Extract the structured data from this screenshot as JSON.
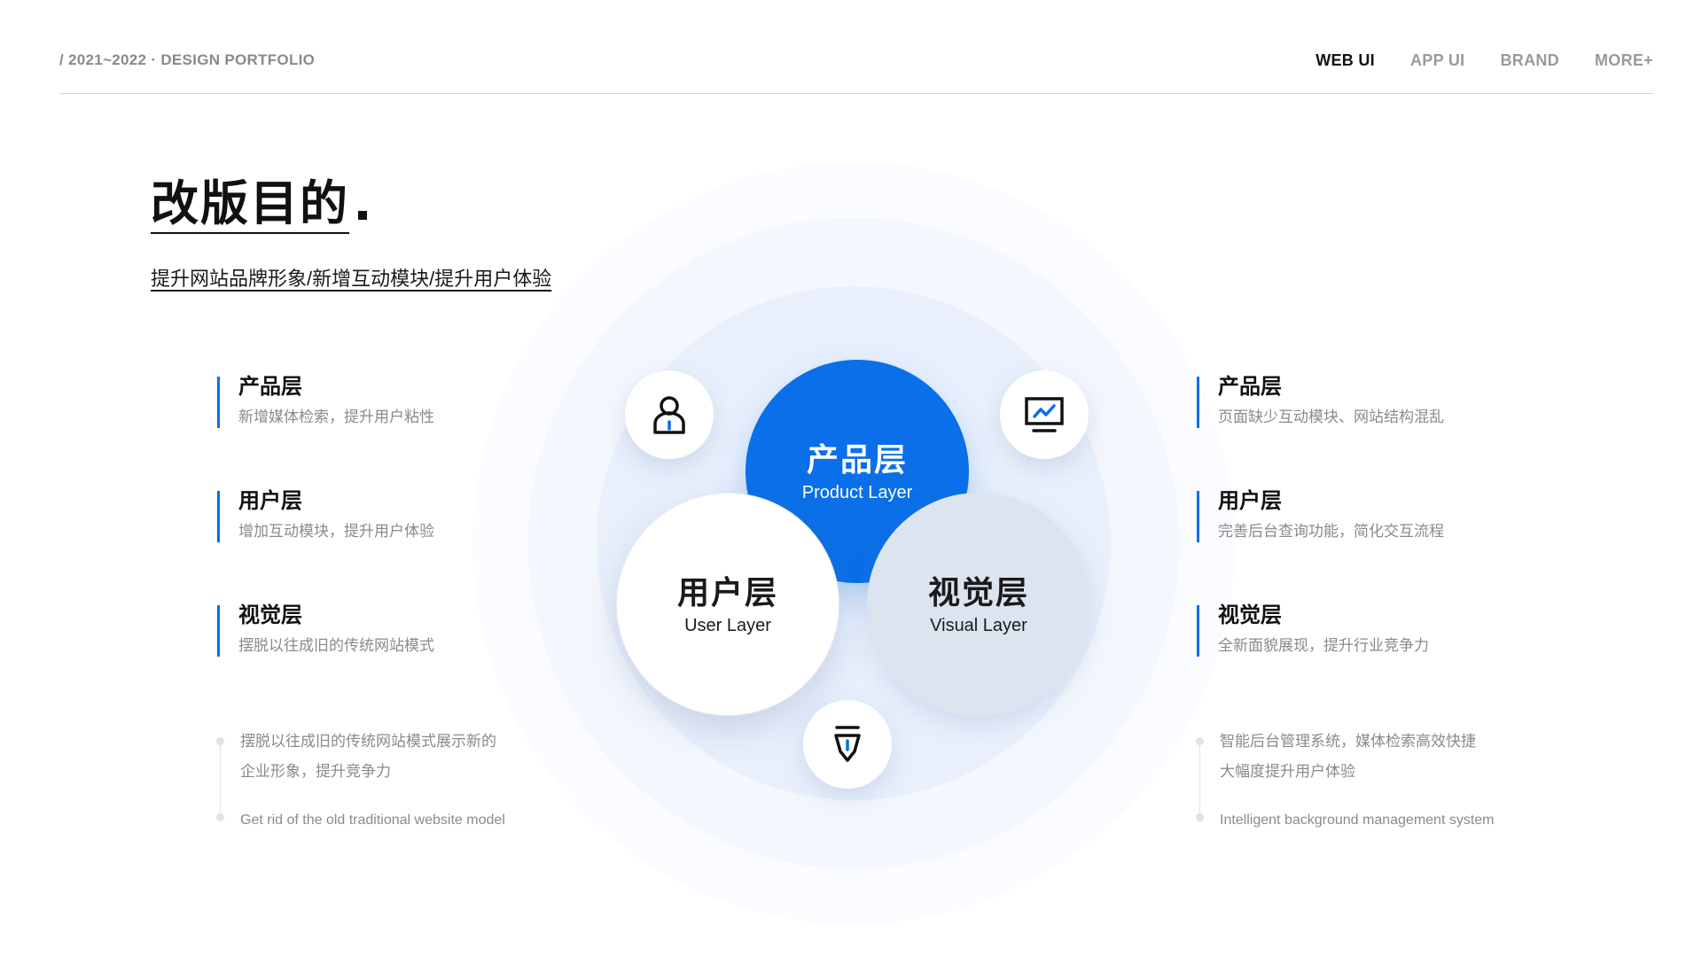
{
  "header": {
    "portfolio_line": "/ 2021~2022 · DESIGN PORTFOLIO",
    "nav": [
      "WEB UI",
      "APP UI",
      "BRAND",
      "MORE+"
    ]
  },
  "hero": {
    "title": "改版目的",
    "subtitle": "提升网站品牌形象/新增互动模块/提升用户体验"
  },
  "left": {
    "items": [
      {
        "title": "产品层",
        "desc": "新增媒体检索，提升用户粘性"
      },
      {
        "title": "用户层",
        "desc": "增加互动模块，提升用户体验"
      },
      {
        "title": "视觉层",
        "desc": "摆脱以往成旧的传统网站模式"
      }
    ],
    "note_line1": "摆脱以往成旧的传统网站模式展示新的",
    "note_line2": "企业形象，提升竞争力",
    "note_en": "Get rid of the old traditional website model"
  },
  "right": {
    "items": [
      {
        "title": "产品层",
        "desc": "页面缺少互动模块、网站结构混乱"
      },
      {
        "title": "用户层",
        "desc": "完善后台查询功能，简化交互流程"
      },
      {
        "title": "视觉层",
        "desc": "全新面貌展现，提升行业竞争力"
      }
    ],
    "note_line1": "智能后台管理系统，媒体检索高效快捷",
    "note_line2": "大幅度提升用户体验",
    "note_en": "Intelligent background management system"
  },
  "circles": {
    "product": {
      "cn": "产品层",
      "en": "Product Layer"
    },
    "user": {
      "cn": "用户层",
      "en": "User Layer"
    },
    "visual": {
      "cn": "视觉层",
      "en": "Visual Layer"
    }
  },
  "icons": [
    "user-icon",
    "monitor-chart-icon",
    "pen-nib-icon"
  ],
  "colors": {
    "accent": "#0a6fe8",
    "visual_circle": "#dce4ef",
    "text": "#111111",
    "muted": "#8a8a8a"
  }
}
